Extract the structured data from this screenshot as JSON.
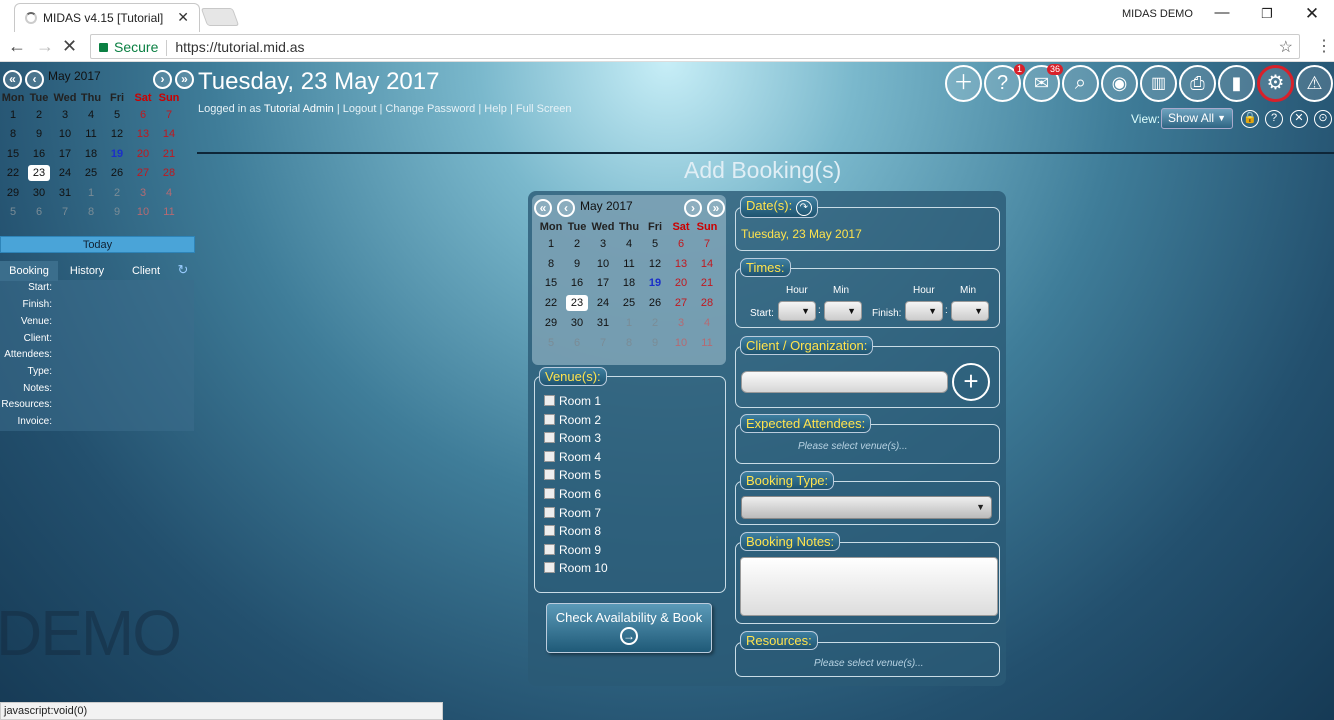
{
  "browser": {
    "tab_title": "MIDAS v4.15 [Tutorial]",
    "window_label": "MIDAS DEMO",
    "secure_label": "Secure",
    "url": "https://tutorial.mid.as",
    "status": "javascript:void(0)"
  },
  "header": {
    "date_title": "Tuesday, 23 May 2017",
    "logged_prefix": "Logged in as",
    "user": "Tutorial Admin",
    "links": [
      "Logout",
      "Change Password",
      "Help",
      "Full Screen"
    ],
    "mail_badge": "36",
    "help_badge": "1",
    "view_label": "View:",
    "view_value": "Show All"
  },
  "mini_calendar": {
    "month": "May 2017",
    "weekdays": [
      "Mon",
      "Tue",
      "Wed",
      "Thu",
      "Fri",
      "Sat",
      "Sun"
    ],
    "today_label": "Today"
  },
  "booking_tabs": [
    "Booking",
    "History",
    "Client"
  ],
  "booking_fields": [
    "Start:",
    "Finish:",
    "Venue:",
    "Client:",
    "Attendees:",
    "Type:",
    "Notes:",
    "Resources:",
    "Invoice:"
  ],
  "watermark": "DEMO",
  "form": {
    "title": "Add Booking(s)",
    "month": "May 2017",
    "dates_legend": "Date(s):",
    "selected_date": "Tuesday, 23 May 2017",
    "times_legend": "Times:",
    "hour": "Hour",
    "min": "Min",
    "start": "Start:",
    "finish": "Finish:",
    "client_legend": "Client / Organization:",
    "attendees_legend": "Expected Attendees:",
    "select_venue": "Please select venue(s)...",
    "type_legend": "Booking Type:",
    "notes_legend": "Booking Notes:",
    "resources_legend": "Resources:",
    "venues_legend": "Venue(s):",
    "venues": [
      "Room 1",
      "Room 2",
      "Room 3",
      "Room 4",
      "Room 5",
      "Room 6",
      "Room 7",
      "Room 8",
      "Room 9",
      "Room 10"
    ],
    "check_button": "Check Availability & Book"
  },
  "calendar_weeks": [
    [
      "1",
      "2",
      "3",
      "4",
      "5",
      "6",
      "7"
    ],
    [
      "8",
      "9",
      "10",
      "11",
      "12",
      "13",
      "14"
    ],
    [
      "15",
      "16",
      "17",
      "18",
      "19",
      "20",
      "21"
    ],
    [
      "22",
      "23",
      "24",
      "25",
      "26",
      "27",
      "28"
    ],
    [
      "29",
      "30",
      "31",
      "1",
      "2",
      "3",
      "4"
    ],
    [
      "5",
      "6",
      "7",
      "8",
      "9",
      "10",
      "11"
    ]
  ]
}
